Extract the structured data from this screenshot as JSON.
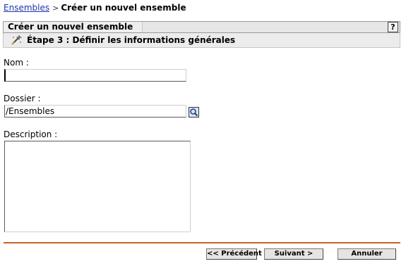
{
  "breadcrumb": {
    "parent_link": "Ensembles",
    "separator": ">",
    "current": "Créer un nouvel ensemble"
  },
  "panel": {
    "title": "Créer un nouvel ensemble",
    "help_label": "?"
  },
  "step": {
    "icon": "wand-icon",
    "title": "Étape 3 : Définir les informations générales"
  },
  "form": {
    "name_label": "Nom :",
    "name_value": "",
    "folder_label": "Dossier :",
    "folder_value": "/Ensembles",
    "browse_icon": "magnifier-icon",
    "description_label": "Description :",
    "description_value": ""
  },
  "buttons": {
    "previous": "<< Précédent",
    "next": "Suivant >",
    "cancel": "Annuler"
  },
  "colors": {
    "link": "#1a35a8",
    "divider": "#c8602a",
    "header_bg": "#e6e6e6"
  }
}
